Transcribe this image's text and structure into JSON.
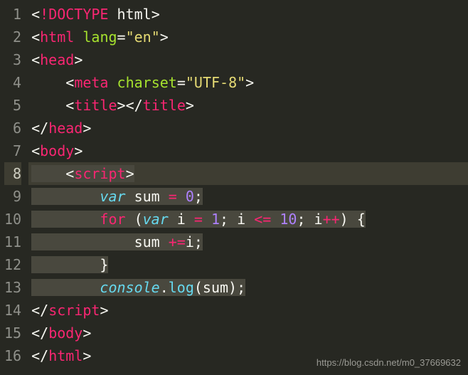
{
  "watermark": "https://blog.csdn.net/m0_37669632",
  "active_line": 8,
  "gutter": [
    "1",
    "2",
    "3",
    "4",
    "5",
    "6",
    "7",
    "8",
    "9",
    "10",
    "11",
    "12",
    "13",
    "14",
    "15",
    "16"
  ],
  "lines": [
    {
      "n": 1,
      "sel": false,
      "tokens": [
        {
          "t": "<",
          "c": "punct"
        },
        {
          "t": "!",
          "c": "tag"
        },
        {
          "t": "DOCTYPE ",
          "c": "tag"
        },
        {
          "t": "html",
          "c": "white"
        },
        {
          "t": ">",
          "c": "punct"
        }
      ]
    },
    {
      "n": 2,
      "sel": false,
      "tokens": [
        {
          "t": "<",
          "c": "punct"
        },
        {
          "t": "html ",
          "c": "tag"
        },
        {
          "t": "lang",
          "c": "attr"
        },
        {
          "t": "=",
          "c": "punct"
        },
        {
          "t": "\"en\"",
          "c": "str"
        },
        {
          "t": ">",
          "c": "punct"
        }
      ]
    },
    {
      "n": 3,
      "sel": false,
      "tokens": [
        {
          "t": "<",
          "c": "punct"
        },
        {
          "t": "head",
          "c": "tag"
        },
        {
          "t": ">",
          "c": "punct"
        }
      ]
    },
    {
      "n": 4,
      "sel": false,
      "tokens": [
        {
          "t": "    ",
          "c": "guide"
        },
        {
          "t": "<",
          "c": "punct"
        },
        {
          "t": "meta ",
          "c": "tag"
        },
        {
          "t": "charset",
          "c": "attr"
        },
        {
          "t": "=",
          "c": "punct"
        },
        {
          "t": "\"UTF-8\"",
          "c": "str"
        },
        {
          "t": ">",
          "c": "punct"
        }
      ]
    },
    {
      "n": 5,
      "sel": false,
      "tokens": [
        {
          "t": "    ",
          "c": "guide"
        },
        {
          "t": "<",
          "c": "punct"
        },
        {
          "t": "title",
          "c": "tag"
        },
        {
          "t": ">",
          "c": "punct"
        },
        {
          "t": "</",
          "c": "punct"
        },
        {
          "t": "title",
          "c": "tag"
        },
        {
          "t": ">",
          "c": "punct"
        }
      ]
    },
    {
      "n": 6,
      "sel": false,
      "tokens": [
        {
          "t": "</",
          "c": "punct"
        },
        {
          "t": "head",
          "c": "tag"
        },
        {
          "t": ">",
          "c": "punct"
        }
      ]
    },
    {
      "n": 7,
      "sel": false,
      "tokens": [
        {
          "t": "<",
          "c": "punct"
        },
        {
          "t": "body",
          "c": "tag"
        },
        {
          "t": ">",
          "c": "punct"
        }
      ]
    },
    {
      "n": 8,
      "sel": true,
      "tokens": [
        {
          "t": "    ",
          "c": "guide"
        },
        {
          "t": "<",
          "c": "punct"
        },
        {
          "t": "script",
          "c": "tag"
        },
        {
          "t": ">",
          "c": "punct"
        }
      ]
    },
    {
      "n": 9,
      "sel": true,
      "tokens": [
        {
          "t": "        ",
          "c": "guide"
        },
        {
          "t": "var",
          "c": "cyan"
        },
        {
          "t": " sum ",
          "c": "ident"
        },
        {
          "t": "=",
          "c": "op"
        },
        {
          "t": " ",
          "c": "ident"
        },
        {
          "t": "0",
          "c": "num"
        },
        {
          "t": ";",
          "c": "punct"
        }
      ]
    },
    {
      "n": 10,
      "sel": true,
      "tokens": [
        {
          "t": "        ",
          "c": "guide"
        },
        {
          "t": "for",
          "c": "kw"
        },
        {
          "t": " (",
          "c": "punct"
        },
        {
          "t": "var",
          "c": "cyan"
        },
        {
          "t": " i ",
          "c": "ident"
        },
        {
          "t": "=",
          "c": "op"
        },
        {
          "t": " ",
          "c": "ident"
        },
        {
          "t": "1",
          "c": "num"
        },
        {
          "t": "; i ",
          "c": "ident"
        },
        {
          "t": "<=",
          "c": "op"
        },
        {
          "t": " ",
          "c": "ident"
        },
        {
          "t": "10",
          "c": "num"
        },
        {
          "t": "; i",
          "c": "ident"
        },
        {
          "t": "++",
          "c": "op"
        },
        {
          "t": ") {",
          "c": "punct"
        }
      ]
    },
    {
      "n": 11,
      "sel": true,
      "tokens": [
        {
          "t": "            ",
          "c": "guide"
        },
        {
          "t": "sum ",
          "c": "ident"
        },
        {
          "t": "+=",
          "c": "op"
        },
        {
          "t": "i;",
          "c": "ident"
        }
      ]
    },
    {
      "n": 12,
      "sel": true,
      "tokens": [
        {
          "t": "        ",
          "c": "guide"
        },
        {
          "t": "}",
          "c": "punct"
        }
      ]
    },
    {
      "n": 13,
      "sel": true,
      "tokens": [
        {
          "t": "        ",
          "c": "guide"
        },
        {
          "t": "console",
          "c": "cyan"
        },
        {
          "t": ".",
          "c": "punct"
        },
        {
          "t": "log",
          "c": "func"
        },
        {
          "t": "(sum);",
          "c": "punct"
        }
      ]
    },
    {
      "n": 14,
      "sel": false,
      "tokens": [
        {
          "t": "</",
          "c": "punct"
        },
        {
          "t": "script",
          "c": "tag"
        },
        {
          "t": ">",
          "c": "punct"
        }
      ]
    },
    {
      "n": 15,
      "sel": false,
      "tokens": [
        {
          "t": "</",
          "c": "punct"
        },
        {
          "t": "body",
          "c": "tag"
        },
        {
          "t": ">",
          "c": "punct"
        }
      ]
    },
    {
      "n": 16,
      "sel": false,
      "tokens": [
        {
          "t": "</",
          "c": "punct"
        },
        {
          "t": "html",
          "c": "tag"
        },
        {
          "t": ">",
          "c": "punct"
        }
      ]
    }
  ]
}
